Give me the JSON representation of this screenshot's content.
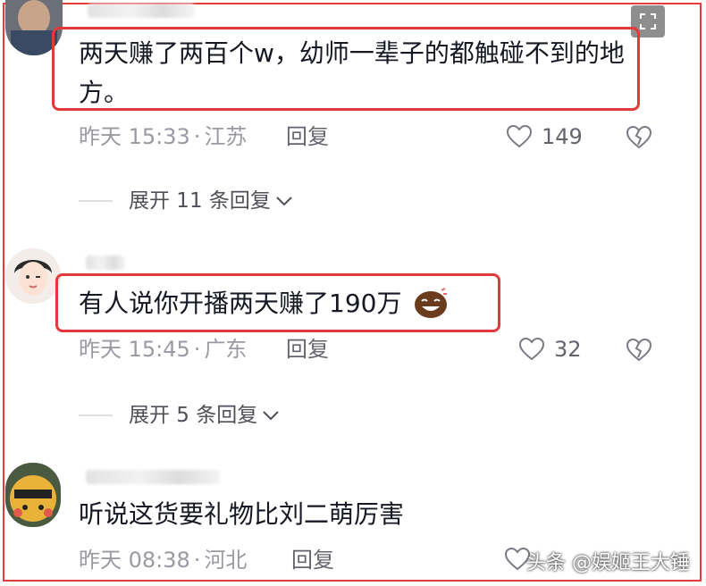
{
  "comments": [
    {
      "text": "两天赚了两百个w，幼师一辈子的都触碰不到的地方。",
      "time": "昨天 15:33",
      "location": "江苏",
      "reply_label": "回复",
      "likes": "149"
    },
    {
      "text": "有人说你开播两天赚了190万",
      "time": "昨天 15:45",
      "location": "广东",
      "reply_label": "回复",
      "likes": "32"
    },
    {
      "text": "听说这货要礼物比刘二萌厉害",
      "time": "昨天 08:38",
      "location": "河北",
      "reply_label": "回复",
      "likes": ""
    }
  ],
  "expand_replies": [
    {
      "label": "展开 11 条回复"
    },
    {
      "label": "展开 5 条回复"
    }
  ],
  "separator": "·",
  "watermark": "头条 @娱姬王大锤",
  "colors": {
    "highlight_border": "#e23a3a",
    "text": "#161823",
    "meta": "#9a9aa2"
  },
  "icons": [
    "expand-icon",
    "heart-icon",
    "broken-heart-icon",
    "chevron-down-icon",
    "laughing-emoji-icon"
  ]
}
